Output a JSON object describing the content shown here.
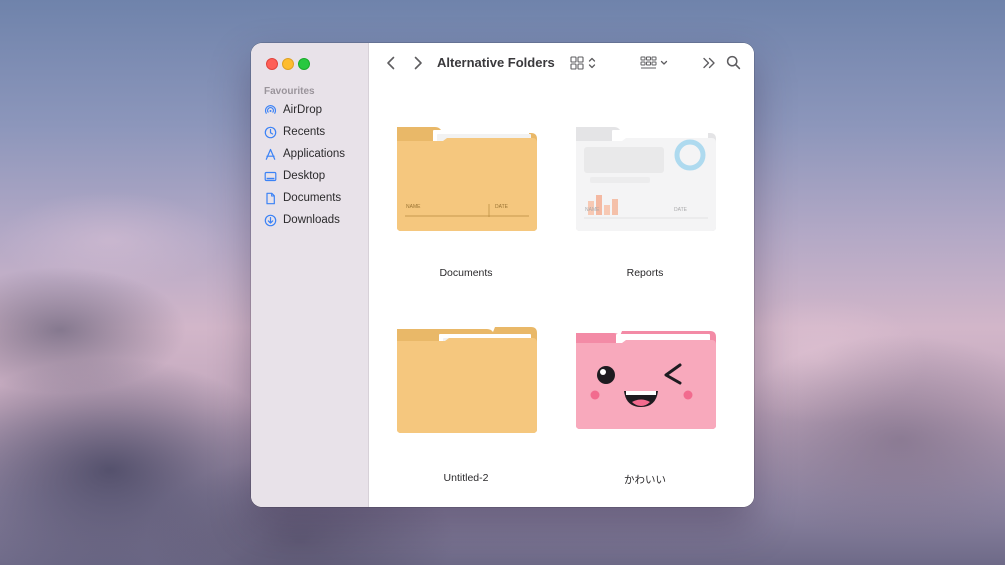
{
  "window": {
    "title": "Alternative Folders"
  },
  "sidebar": {
    "section_title": "Favourites",
    "items": [
      {
        "label": "AirDrop",
        "icon": "airdrop-icon"
      },
      {
        "label": "Recents",
        "icon": "clock-icon"
      },
      {
        "label": "Applications",
        "icon": "applications-icon"
      },
      {
        "label": "Desktop",
        "icon": "desktop-icon"
      },
      {
        "label": "Documents",
        "icon": "document-icon"
      },
      {
        "label": "Downloads",
        "icon": "download-icon"
      }
    ]
  },
  "files": [
    {
      "name": "Documents",
      "icon": "folder-icon",
      "tab_labels": [
        "NAME",
        "DATE"
      ]
    },
    {
      "name": "Reports",
      "icon": "report-folder-icon",
      "tab_labels": [
        "NAME",
        "DATE"
      ]
    },
    {
      "name": "Untitled-2",
      "icon": "folder-icon"
    },
    {
      "name": "かわいい",
      "icon": "kawaii-folder-icon"
    }
  ],
  "colors": {
    "accent": "#3b82f6",
    "folder": "#f4c57a",
    "pink_folder": "#f7a5b9"
  }
}
